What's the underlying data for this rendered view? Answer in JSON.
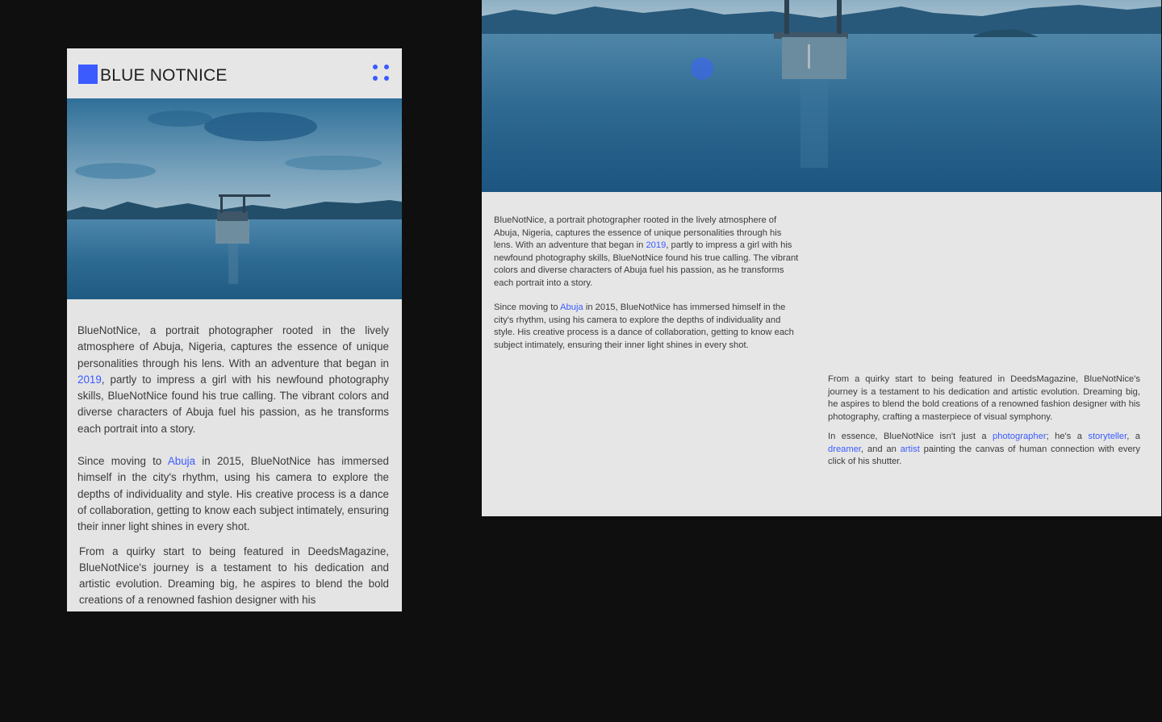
{
  "mobile": {
    "brand": "BLUE NOTNICE",
    "menu_icon": "dots-grid-icon",
    "accent": "#3b5bff",
    "paragraphs": {
      "p1": {
        "a": "BlueNotNice, a portrait photographer rooted in the lively atmosphere of Abuja, Nigeria, captures the essence of unique personalities through his lens. With an adventure that began in ",
        "link": "2019",
        "b": ", partly to impress a girl with his newfound photography skills, BlueNotNice found his true calling. The vibrant colors and diverse characters of Abuja fuel his passion, as he transforms each portrait into a story."
      },
      "p2": {
        "a": "Since moving to ",
        "link": "Abuja",
        "b": " in 2015, BlueNotNice has immersed himself in the city's rhythm, using his camera to explore the depths of individuality and style. His creative process is a dance of collaboration, getting to know each subject intimately, ensuring their inner light shines in every shot."
      },
      "p3": "From a quirky start to being featured in DeedsMagazine, BlueNotNice's journey is a testament to his dedication and artistic evolution. Dreaming big, he aspires to blend the bold creations of a renowned fashion designer with his"
    }
  },
  "desktop": {
    "col1": {
      "p1": {
        "a": "BlueNotNice, a portrait photographer rooted in the lively atmosphere of Abuja, Nigeria, captures the essence of unique personalities through his lens. With an adventure that began in ",
        "link": "2019",
        "b": ", partly to impress a girl with his newfound photography skills, BlueNotNice found his true calling. The vibrant colors and diverse characters of Abuja fuel his passion, as he transforms each portrait into a story."
      },
      "p2": {
        "a": "Since moving to ",
        "link": "Abuja",
        "b": " in 2015, BlueNotNice has immersed himself in the city's rhythm, using his camera to explore the depths of individuality and style. His creative process is a dance of collaboration, getting to know each subject intimately, ensuring their inner light shines in every shot."
      }
    },
    "col2": {
      "p3": "From a quirky start to being featured in DeedsMagazine, BlueNotNice's journey is a testament to his dedication and artistic evolution. Dreaming big, he aspires to blend the bold creations of a renowned fashion designer with his photography, crafting a masterpiece of visual symphony.",
      "p4": {
        "a": "In essence, BlueNotNice isn't just a ",
        "link1": "photographer",
        "b": "; he's a ",
        "link2": "storyteller",
        "c": ", a ",
        "link3": "dreamer",
        "d": ", and an ",
        "link4": "artist",
        "e": " painting the canvas of human connection with every click of his shutter."
      }
    }
  }
}
